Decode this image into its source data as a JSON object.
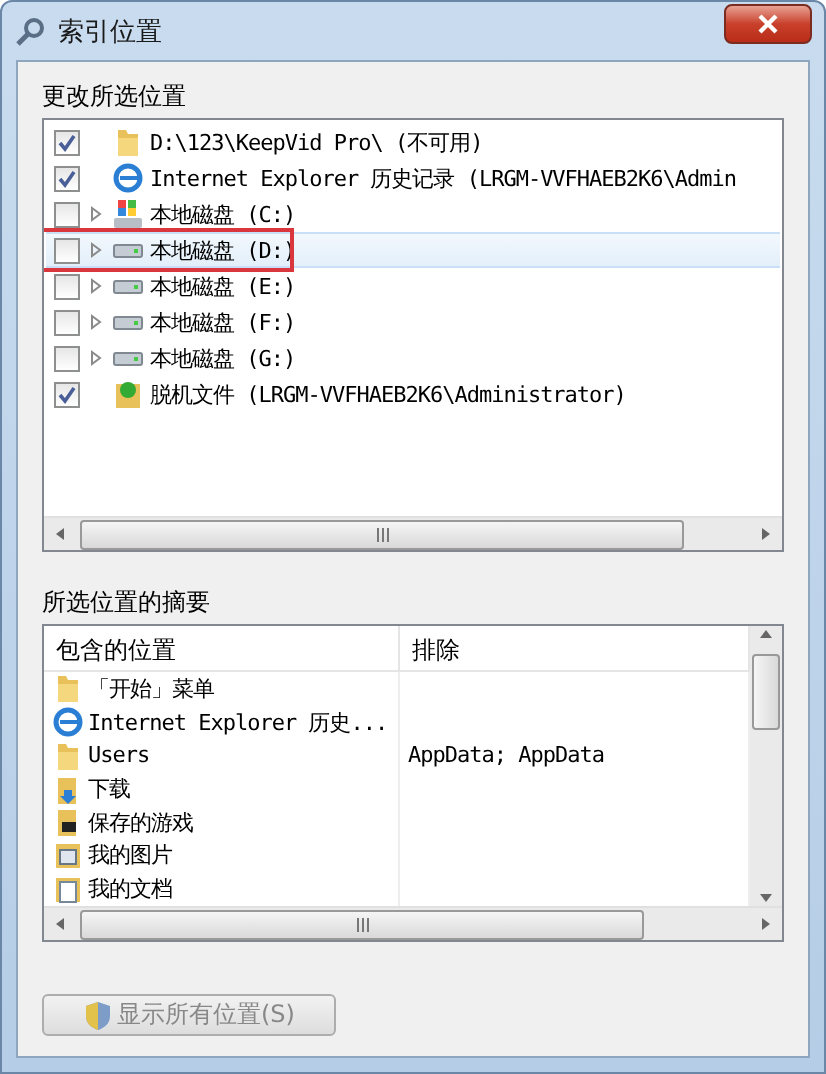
{
  "window": {
    "title": "索引位置"
  },
  "locations": {
    "label": "更改所选位置",
    "items": [
      {
        "kind": "folder",
        "text": "D:\\123\\KeepVid Pro\\ (不可用)",
        "checked": true,
        "expandable": false,
        "selected": false,
        "marked": false
      },
      {
        "kind": "ie",
        "text": "Internet Explorer 历史记录 (LRGM-VVFHAEB2K6\\Admin",
        "checked": true,
        "expandable": false,
        "selected": false,
        "marked": false
      },
      {
        "kind": "system-drive",
        "text": "本地磁盘 (C:)",
        "checked": false,
        "expandable": true,
        "selected": false,
        "marked": false
      },
      {
        "kind": "drive",
        "text": "本地磁盘 (D:)",
        "checked": false,
        "expandable": true,
        "selected": true,
        "marked": true
      },
      {
        "kind": "drive",
        "text": "本地磁盘 (E:)",
        "checked": false,
        "expandable": true,
        "selected": false,
        "marked": false
      },
      {
        "kind": "drive",
        "text": "本地磁盘 (F:)",
        "checked": false,
        "expandable": true,
        "selected": false,
        "marked": false
      },
      {
        "kind": "drive",
        "text": "本地磁盘 (G:)",
        "checked": false,
        "expandable": true,
        "selected": false,
        "marked": false
      },
      {
        "kind": "offline",
        "text": "脱机文件 (LRGM-VVFHAEB2K6\\Administrator)",
        "checked": true,
        "expandable": false,
        "selected": false,
        "marked": false
      }
    ]
  },
  "summary": {
    "label": "所选位置的摘要",
    "columns": [
      "包含的位置",
      "排除"
    ],
    "rows": [
      {
        "kind": "folder",
        "included": "「开始」菜单"
      },
      {
        "kind": "ie",
        "included": "Internet Explorer 历史..."
      },
      {
        "kind": "folder",
        "included": "Users",
        "excluded": "AppData; AppData"
      },
      {
        "kind": "download",
        "included": "下载"
      },
      {
        "kind": "games",
        "included": "保存的游戏"
      },
      {
        "kind": "pictures",
        "included": "我的图片"
      },
      {
        "kind": "documents",
        "included": "我的文档"
      }
    ]
  },
  "buttons": [
    {
      "label": "显示所有位置(S)",
      "shield": true
    }
  ]
}
